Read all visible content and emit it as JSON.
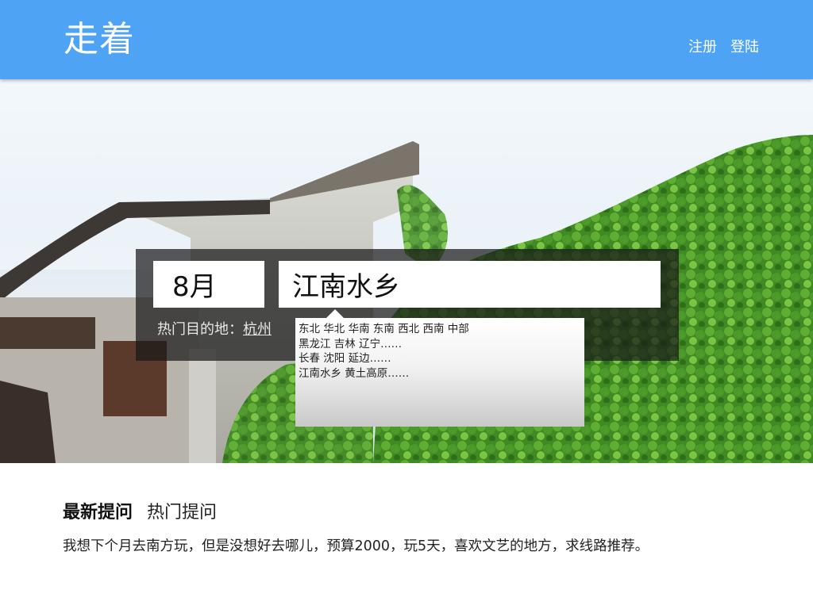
{
  "header": {
    "logo": "走着",
    "nav": {
      "register": "注册",
      "login": "登陆"
    }
  },
  "colors": {
    "header_bg": "#4ea3f5",
    "panel_bg": "rgba(25,25,25,0.72)"
  },
  "search": {
    "month_value": "8月",
    "destination_value": "江南水乡",
    "hot_label": "热门目的地：",
    "hot_link": "杭州",
    "dropdown": {
      "lines": [
        "东北 华北 华南 东南 西北 西南 中部",
        "黑龙江 吉林 辽宁……",
        "长春 沈阳 延边……",
        "江南水乡 黄土高原……"
      ]
    }
  },
  "questions": {
    "tabs": [
      "最新提问",
      "热门提问"
    ],
    "items": [
      "我想下个月去南方玩，但是没想好去哪儿，预算2000，玩5天，喜欢文艺的地方，求线路推荐。"
    ]
  }
}
